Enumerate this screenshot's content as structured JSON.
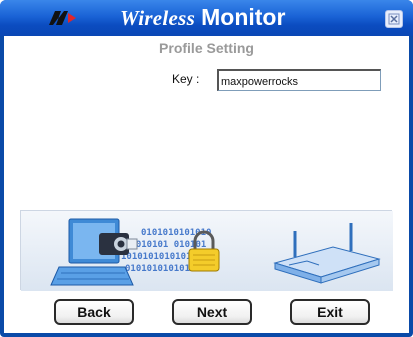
{
  "window": {
    "title_wireless": "Wireless",
    "title_monitor": "Monitor",
    "logo_icon": "brand-logo-icon",
    "close_icon": "close-icon"
  },
  "form": {
    "subtitle": "Profile Setting",
    "key_label": "Key :",
    "key_value": "maxpowerrocks"
  },
  "illustration": {
    "binary_rows": [
      "0101010101010",
      "01010101 010101",
      "101010101010101",
      "0101010101010101"
    ],
    "icons": [
      "laptop-icon",
      "camera-icon",
      "padlock-icon",
      "router-icon"
    ]
  },
  "buttons": {
    "back": "Back",
    "next": "Next",
    "exit": "Exit"
  },
  "colors": {
    "titlebar": "#1a63d6",
    "frame": "#0a4aa8",
    "subtitle": "#9a9a9a"
  }
}
